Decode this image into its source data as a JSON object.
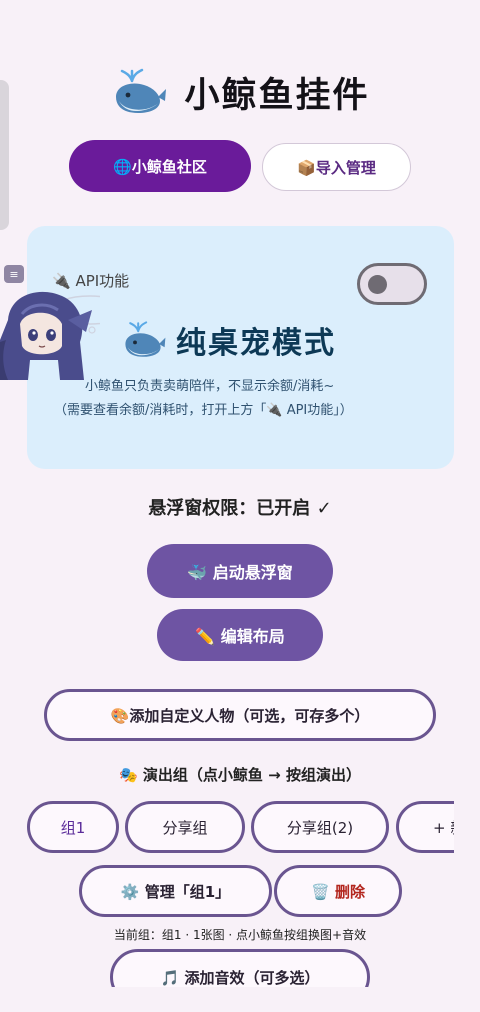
{
  "app": {
    "title": "小鲸鱼挂件",
    "title_icon": "whale-icon"
  },
  "top_buttons": {
    "community": "🌐小鲸鱼社区",
    "import_manage": "📦导入管理"
  },
  "pet_card": {
    "api_label": "🔌 API功能",
    "api_toggle_on": false,
    "mode_title": "纯桌宠模式",
    "description": "小鲸鱼只负责卖萌陪伴，不显示余额/消耗~",
    "note": "（需要查看余额/消耗时，打开上方「🔌 API功能」）"
  },
  "permission_status": "悬浮窗权限：已开启 ✓",
  "actions": {
    "start_float": "🐳 启动悬浮窗",
    "edit_layout": "✏️ 编辑布局",
    "add_character": "🎨添加自定义人物（可选，可存多个）"
  },
  "show_group": {
    "label": "🎭 演出组（点小鲸鱼 → 按组演出）",
    "chips": [
      "组1",
      "分享组",
      "分享组(2)",
      "+ 新"
    ],
    "selected_index": 0,
    "manage": "⚙️ 管理「组1」",
    "delete": "🗑️ 删除",
    "current": "当前组：组1 · 1张图 · 点小鲸鱼按组换图+音效",
    "add_sound": "🎵 添加音效（可多选）"
  },
  "colors": {
    "background": "#f8f1f8",
    "primary_purple": "#6a1b9a",
    "button_purple": "#6e54a3",
    "card_blue": "#dbeefc",
    "delete_red": "#b3261e"
  }
}
